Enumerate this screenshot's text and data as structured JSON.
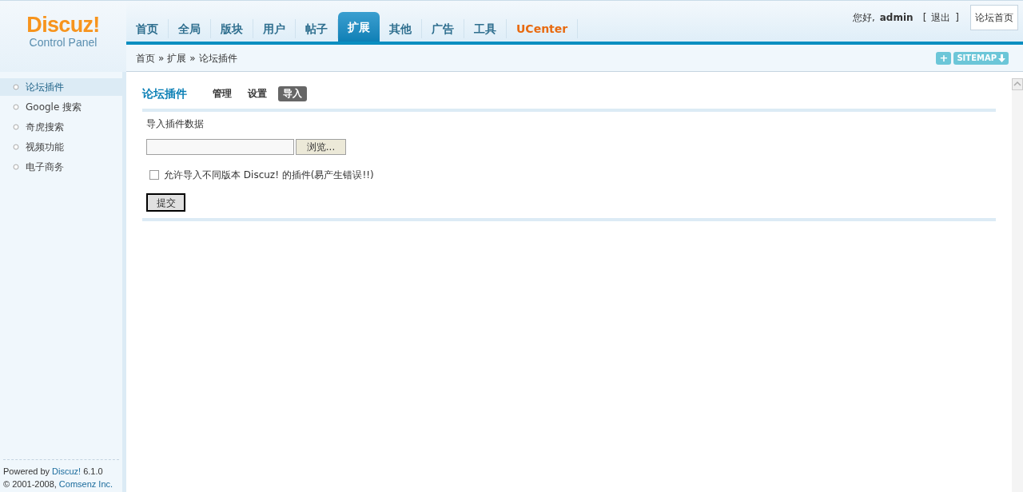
{
  "logo": {
    "brand": "Discuz!",
    "subtitle": "Control Panel"
  },
  "nav": [
    {
      "label": "首页",
      "selected": false,
      "kind": "normal"
    },
    {
      "label": "全局",
      "selected": false,
      "kind": "normal"
    },
    {
      "label": "版块",
      "selected": false,
      "kind": "normal"
    },
    {
      "label": "用户",
      "selected": false,
      "kind": "normal"
    },
    {
      "label": "帖子",
      "selected": false,
      "kind": "normal"
    },
    {
      "label": "扩展",
      "selected": true,
      "kind": "normal"
    },
    {
      "label": "其他",
      "selected": false,
      "kind": "normal"
    },
    {
      "label": "广告",
      "selected": false,
      "kind": "normal"
    },
    {
      "label": "工具",
      "selected": false,
      "kind": "normal"
    },
    {
      "label": "UCenter",
      "selected": false,
      "kind": "highlight"
    }
  ],
  "user": {
    "greeting": "您好,",
    "name": "admin",
    "bracket_open": "[",
    "logout": "退出",
    "bracket_close": "]",
    "home_button": "论坛首页"
  },
  "breadcrumb": [
    "首页",
    "扩展",
    "论坛插件"
  ],
  "breadcrumb_separator": "»",
  "sitemap": {
    "plus": "+",
    "label": "SITEMAP"
  },
  "sidebar": {
    "items": [
      {
        "label": "论坛插件",
        "selected": true
      },
      {
        "label": "Google 搜索",
        "selected": false
      },
      {
        "label": "奇虎搜索",
        "selected": false
      },
      {
        "label": "视频功能",
        "selected": false
      },
      {
        "label": "电子商务",
        "selected": false
      }
    ],
    "footer": {
      "powered": "Powered by",
      "link": "Discuz!",
      "version": "6.1.0",
      "copyright": "© 2001-2008,",
      "company": "Comsenz Inc."
    }
  },
  "content": {
    "title": "论坛插件",
    "tabs": [
      {
        "label": "管理",
        "selected": false
      },
      {
        "label": "设置",
        "selected": false
      },
      {
        "label": "导入",
        "selected": true
      }
    ],
    "section_label": "导入插件数据",
    "browse_button": "浏览...",
    "allow_checkbox": {
      "label": "允许导入不同版本 Discuz! 的插件(易产生错误!!)",
      "checked": false
    },
    "submit": "提交"
  }
}
